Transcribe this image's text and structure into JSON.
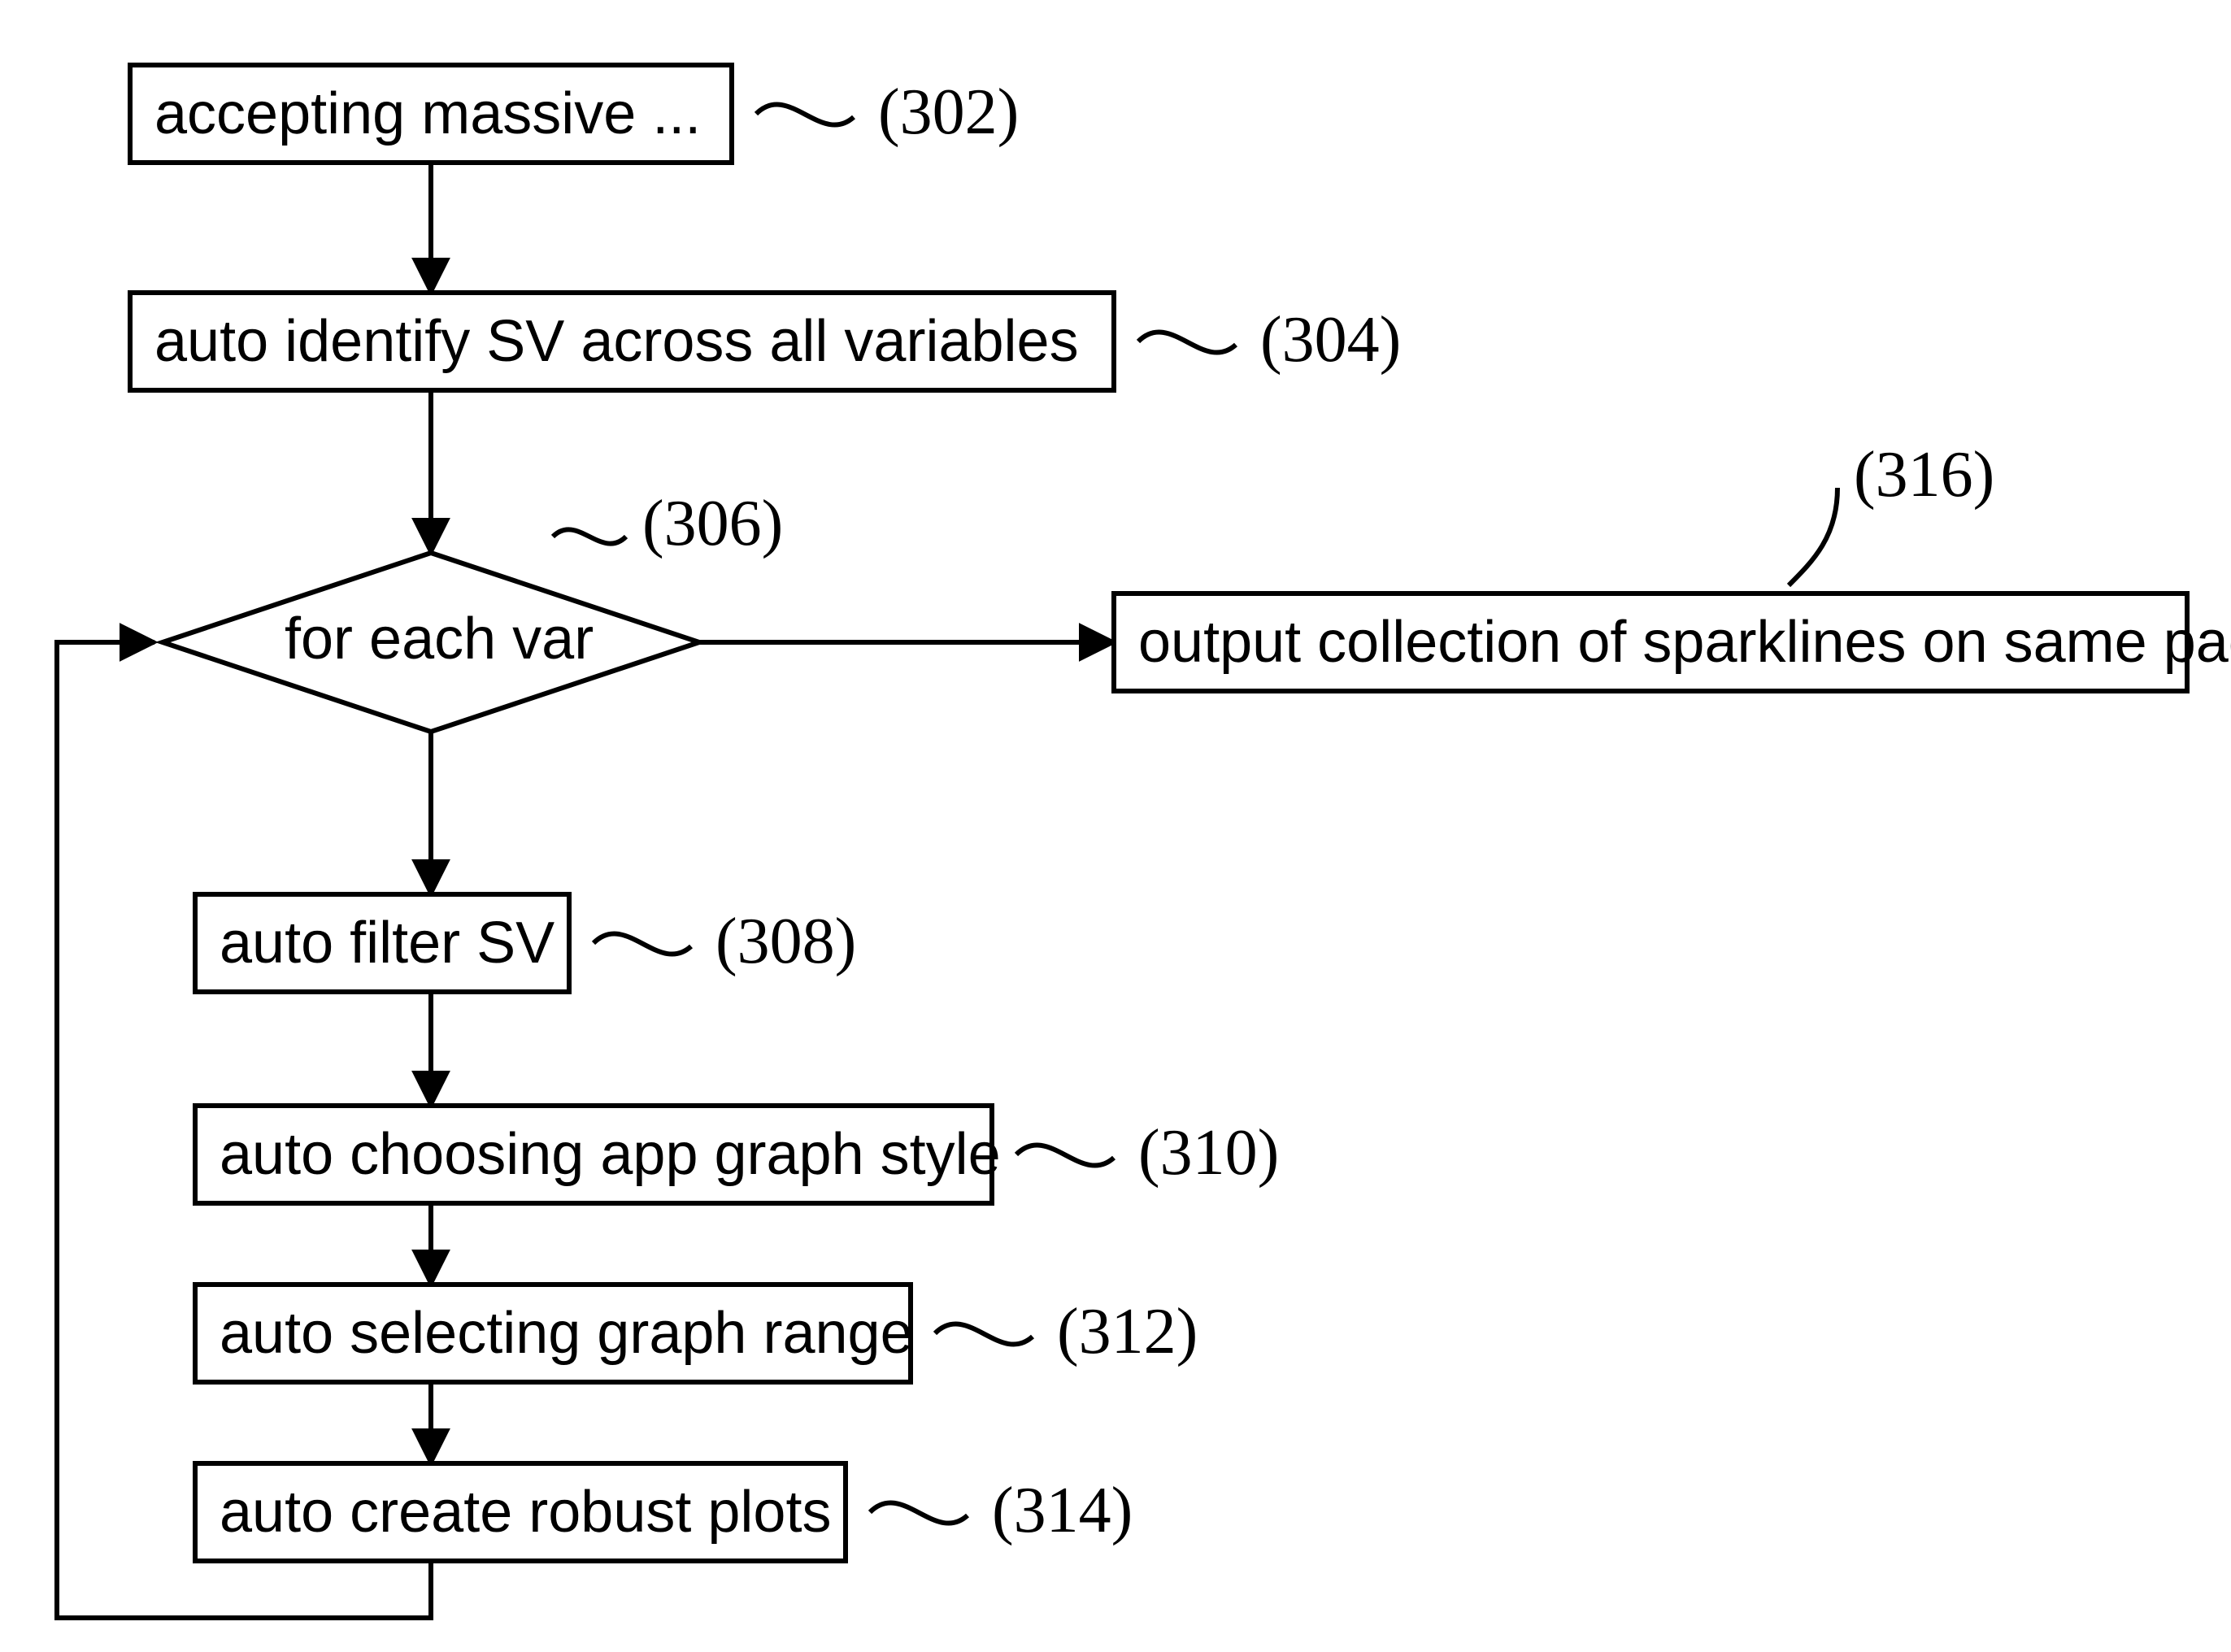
{
  "nodes": {
    "n302": {
      "text": "accepting massive ...",
      "ref": "(302)"
    },
    "n304": {
      "text": "auto identify SV across all variables",
      "ref": "(304)"
    },
    "n306": {
      "text": "for each var",
      "ref": "(306)"
    },
    "n308": {
      "text": "auto filter SV",
      "ref": "(308)"
    },
    "n310": {
      "text": "auto choosing app graph style",
      "ref": "(310)"
    },
    "n312": {
      "text": "auto selecting graph range",
      "ref": "(312)"
    },
    "n314": {
      "text": "auto create robust plots",
      "ref": "(314)"
    },
    "n316": {
      "text": "output collection of sparklines on same page",
      "ref": "(316)"
    }
  }
}
